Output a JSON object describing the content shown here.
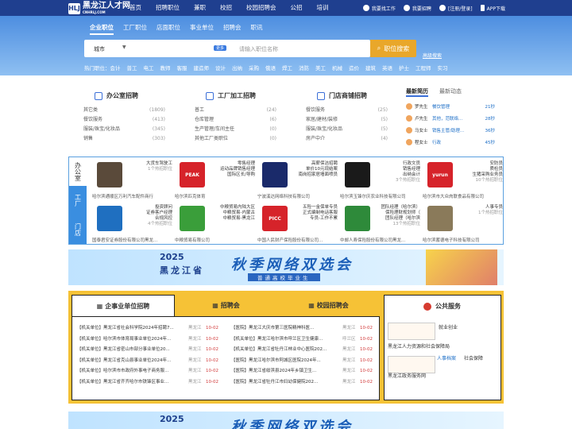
{
  "site": {
    "logo_mark": "HLJ",
    "logo_name": "黑龙江人才网",
    "logo_sub": "CNHRLJ.COM"
  },
  "nav": [
    "首页",
    "招聘职位",
    "兼职",
    "校招",
    "校园招聘会",
    "公招",
    "培训"
  ],
  "topright": [
    "我要找工作",
    "我要招聘",
    "[注册/登录]",
    "APP下载"
  ],
  "search": {
    "tabs": [
      "企业职位",
      "工厂职位",
      "店面职位",
      "事业单位",
      "招聘会",
      "职讯"
    ],
    "city": "城市",
    "more": "更多",
    "placeholder": "请输入职位名称",
    "button": "职位搜索",
    "advanced": "高级搜索"
  },
  "hot": [
    "热门职位：会计",
    "普工",
    "电工",
    "教师",
    "客服",
    "建造师",
    "设计",
    "出纳",
    "采购",
    "俄语",
    "焊工",
    "消防",
    "美工",
    "机械",
    "造价",
    "建筑",
    "英语",
    "护士",
    "工程师",
    "实习"
  ],
  "office": {
    "title": "办公室招聘",
    "items": [
      {
        "n": "其它类",
        "c": "(1809)"
      },
      {
        "n": "餐饮服务",
        "c": "(413)"
      },
      {
        "n": "服装/珠宝/化妆品",
        "c": "(345)"
      },
      {
        "n": "销售",
        "c": "(303)"
      }
    ]
  },
  "factory": {
    "title": "工厂加工招聘",
    "items": [
      {
        "n": "普工",
        "c": "(24)"
      },
      {
        "n": "仓库管理",
        "c": "(6)"
      },
      {
        "n": "生产管理/车间主任",
        "c": "(0)"
      },
      {
        "n": "其他工厂类职位",
        "c": "(0)"
      }
    ]
  },
  "shop": {
    "title": "门店商铺招聘",
    "items": [
      {
        "n": "餐饮服务",
        "c": "(25)"
      },
      {
        "n": "家居/建材/装修",
        "c": "(5)"
      },
      {
        "n": "服装/珠宝/化妆品",
        "c": "(5)"
      },
      {
        "n": "房产中介",
        "c": "(4)"
      }
    ]
  },
  "recent": {
    "tabs": [
      "最新简历",
      "最新动态"
    ],
    "items": [
      {
        "n": "罗先生",
        "j": "餐饮管理",
        "t": "21秒"
      },
      {
        "n": "卢先生",
        "j": "其他，范联络...",
        "t": "28秒"
      },
      {
        "n": "马女士",
        "j": "销售主管/助理...",
        "t": "36秒"
      },
      {
        "n": "程女士",
        "j": "行政",
        "t": "45秒"
      }
    ]
  },
  "sidetabs": [
    "办公室",
    "工厂",
    "门店"
  ],
  "companies": [
    {
      "jobs": [
        "大货车驾驶工"
      ],
      "cnt": "1个热招职位",
      "name": "哈尔滨通顺区万利汽车配件商行",
      "logo": "",
      "color": "#5a4a3a"
    },
    {
      "jobs": [
        "零售经理",
        "运动品牌销售经理",
        "国际区长/导购"
      ],
      "cnt": "",
      "name": "哈尔滨匹克体育",
      "logo": "PEAK",
      "color": "#d6232a"
    },
    {
      "jobs": [
        "高薪保洁招聘",
        "单价10元现结案",
        "南岗招家居墙面喷员"
      ],
      "cnt": "",
      "name": "宁波溪达网络科技有限公司",
      "logo": "",
      "color": "#1a2a6a"
    },
    {
      "jobs": [
        "行政文员",
        "销售经理",
        "出纳会计"
      ],
      "cnt": "3个热招职位",
      "name": "哈尔滨玉锋尔庆农业科技有限公司",
      "logo": "",
      "color": "#1a1a1a"
    },
    {
      "jobs": [
        "安防员",
        "质检员",
        "生猪采购业务员"
      ],
      "cnt": "10个热招职位",
      "name": "哈尔滨市大众肉联食品有限公司",
      "logo": "yurun",
      "color": "#d6232a"
    },
    {
      "jobs": [
        "投资顾问",
        "证券客户经理",
        "合规风控"
      ],
      "cnt": "4个热招职位",
      "name": "国泰君安证券股份有限公司黑龙...",
      "logo": "",
      "color": "#1f6fc0"
    },
    {
      "jobs": [
        "中粮贸易内陆大区",
        "中粮贸易-内蒙古",
        "中粮贸易-黑龙江"
      ],
      "cnt": "",
      "name": "中粮贸易有限公司",
      "logo": "",
      "color": "#3a9e3a"
    },
    {
      "jobs": [
        "五险一金保单专员",
        "正式编制电话客服",
        "专员-工作不累"
      ],
      "cnt": "",
      "name": "中国人民财产保险股份有限公司...",
      "logo": "PICC",
      "color": "#d6232a"
    },
    {
      "jobs": [
        "团队经理（哈尔滨）",
        "保险理财规划师（",
        "团队经理（哈尔滨"
      ],
      "cnt": "13个热招职位",
      "name": "中邮人寿保险股份有限公司黑龙...",
      "logo": "",
      "color": "#2e8a3a"
    },
    {
      "jobs": [
        "人事专员"
      ],
      "cnt": "1个热招职位",
      "name": "哈尔滨蓄德电子科技有限公司",
      "logo": "",
      "color": "#8a7a5a"
    }
  ],
  "banner": {
    "yr": "2025",
    "prov": "黑龙江省",
    "big": "秋季网络双选会",
    "small": "普通高校毕业生"
  },
  "gtabs": [
    "企事业单位招聘",
    "招聘会",
    "校园招聘会"
  ],
  "news_left": [
    {
      "t": "【机关单位】黑龙江省社会科学院2024年招聘7...",
      "c": "黑龙江",
      "d": "10-02"
    },
    {
      "t": "【机关单位】哈尔滨市体育局事业单位2024年...",
      "c": "黑龙江",
      "d": "10-02"
    },
    {
      "t": "【机关单位】黑龙江省密山市部分事业单位20...",
      "c": "黑龙江",
      "d": "10-02"
    },
    {
      "t": "【机关单位】黑龙江省克山县事业单位2024年...",
      "c": "黑龙江",
      "d": "10-02"
    },
    {
      "t": "【机关单位】哈尔滨市市政府外事电子商务服...",
      "c": "黑龙江",
      "d": "10-02"
    },
    {
      "t": "【机关单位】黑龙江省齐齐哈尔市铁锋区事业...",
      "c": "黑龙江",
      "d": "10-02"
    }
  ],
  "news_right": [
    {
      "t": "【医院】黑龙江大庆市第三医院精神科医...",
      "c": "黑龙江",
      "d": "10-02"
    },
    {
      "t": "【机关单位】黑龙江哈尔滨市呼兰区卫生健康...",
      "c": "呼兰区",
      "d": "10-02"
    },
    {
      "t": "【机关单位】黑龙江省牡丹江林业中心医院202...",
      "c": "黑龙江",
      "d": "10-02"
    },
    {
      "t": "【医院】黑龙江哈尔滨市阿城区医院2024年...",
      "c": "黑龙江",
      "d": "10-02"
    },
    {
      "t": "【医院】黑龙江省绥滨县2024年乡镇卫生...",
      "c": "黑龙江",
      "d": "10-02"
    },
    {
      "t": "【医院】黑龙江省牡丹江市妇幼保健院202...",
      "c": "黑龙江",
      "d": "10-02"
    }
  ],
  "service": {
    "title": "公共服务",
    "rows": [
      {
        "a": "",
        "b": "就业创业",
        "c": "黑龙江人力资源和社会保障局"
      },
      {
        "a": "人事档案",
        "b": "社会保障",
        "c": "黑龙江政务服务网"
      }
    ]
  }
}
